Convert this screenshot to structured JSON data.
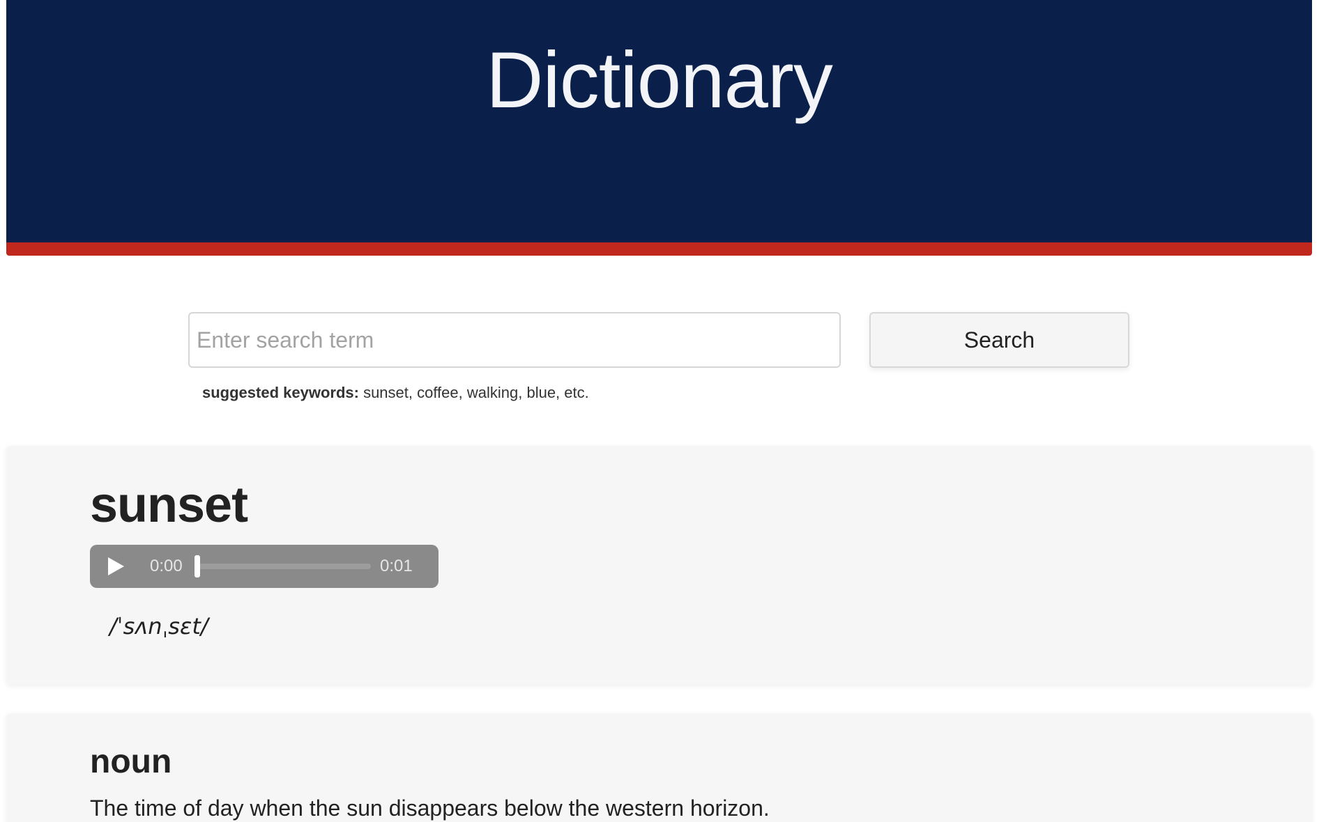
{
  "header": {
    "title": "Dictionary"
  },
  "search": {
    "placeholder": "Enter search term",
    "value": "",
    "button_label": "Search",
    "suggest_label": "suggested keywords:",
    "suggest_values": " sunset, coffee, walking, blue, etc."
  },
  "entry": {
    "word": "sunset",
    "phonetic": "/ˈsʌnˌsɛt/",
    "audio": {
      "current_time": "0:00",
      "total_time": "0:01",
      "progress": 0
    }
  },
  "meaning": {
    "part_of_speech": "noun",
    "definition": "The time of day when the sun disappears below the western horizon."
  },
  "colors": {
    "header_bg": "#0a1f4a",
    "header_stripe": "#c0281d",
    "card_bg": "#f6f6f6",
    "audio_player_bg": "#8a8a8a"
  },
  "icons": {
    "play": "play-icon"
  }
}
